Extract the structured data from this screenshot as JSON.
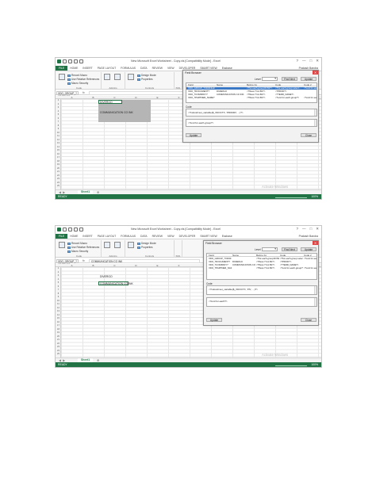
{
  "accent_color": "#217346",
  "selection_color": "#3a78c6",
  "screenshots": [
    {
      "window_title": "New Microsoft Excel Worksheet - Copy.xls [Compatibility Mode] - Excel",
      "window_controls": [
        "?",
        "—",
        "□",
        "✕"
      ],
      "tabs": [
        "FILE",
        "HOME",
        "INSERT",
        "PAGE LAYOUT",
        "FORMULAS",
        "DATA",
        "REVIEW",
        "VIEW",
        "DEVELOPER",
        "SMART VIEW",
        "Essbase"
      ],
      "user": "Prakash Bandra",
      "ribbon_items": [
        "Record Macro",
        "Use Relative References",
        "Macro Security",
        "Add-Ins",
        "COM Add-Ins",
        "Insert",
        "Design Mode",
        "Properties",
        "View Code",
        "Run Dialog",
        "Source",
        "Map Properties",
        "Expansion Packs",
        "Refresh Data",
        "Import",
        "Export",
        "Document Panel",
        "XML Maps",
        "Field Browser"
      ],
      "ribbon_groups": [
        "Code",
        "Add-Ins",
        "Controls",
        "XML",
        "Modify"
      ],
      "name_box": "XDO_GROUP_?XDOFILE?",
      "fx": "fx",
      "formula": "",
      "columns": [
        "A",
        "B",
        "C",
        "D",
        "E",
        "F",
        "G",
        "H",
        "I",
        "J",
        "K",
        "L"
      ],
      "rows": [
        "1",
        "2",
        "3",
        "4",
        "5",
        "6",
        "7",
        "8",
        "9",
        "10",
        "11",
        "12",
        "13",
        "14",
        "15",
        "16",
        "17",
        "18",
        "19",
        "20",
        "21",
        "22",
        "23",
        "24",
        "25"
      ],
      "cells": [
        {
          "text": "DIVERGO"
        },
        {
          "text": "COMMUNICATION CO INK"
        }
      ],
      "sheet_tab": "Sheet1",
      "status": "READY",
      "zoom": "100%",
      "watermark": "Activate Windows",
      "dialog": {
        "title": "Field Browser",
        "close": "✕",
        "level_label": "Level",
        "find_button": "Find Next",
        "update_button": "Update",
        "columns": [
          "Field",
          "Name",
          "Before Fo",
          "Code",
          "Code 2"
        ],
        "rows": [
          [
            "XDO_GROUP_?XDOFILE?",
            "",
            "<?for-each-group:ROW?>",
            "<?for-each-group select:...",
            "<?end for-each?>"
          ],
          [
            "XDO_?DOCUMENT?",
            "DIVERGO",
            "<?fbow-?:G1.B1?>",
            "<?PROD?>",
            ""
          ],
          [
            "XDO_?COMPANY?",
            "COMMUNICATION CO INK",
            "<?fbow-?:G1.B1?>",
            "<?TERR_NAME?>",
            ""
          ],
          [
            "XDO_?PARTNER_NAME?",
            "",
            "<?fbow-?:G1.B1?>",
            "<?end for-each-group?>",
            "<?end for-each?>"
          ]
        ],
        "code_label": "Code",
        "code_text_1": "<?xdoxslt:set_variable($_XDOCTX, 'PRODID', ...)?>",
        "code_text_2": "<?end for-each-group?>",
        "update_button_2": "Update",
        "close_button": "Close"
      }
    },
    {
      "window_title": "New Microsoft Excel Worksheet - Copy.xls [Compatibility Mode] - Excel",
      "window_controls": [
        "?",
        "—",
        "□",
        "✕"
      ],
      "tabs": [
        "FILE",
        "HOME",
        "INSERT",
        "PAGE LAYOUT",
        "FORMULAS",
        "DATA",
        "REVIEW",
        "VIEW",
        "DEVELOPER",
        "SMART VIEW",
        "Essbase"
      ],
      "user": "Prakash Bandra",
      "ribbon_items": [
        "Record Macro",
        "Use Relative References",
        "Macro Security",
        "Add-Ins",
        "COM Add-Ins",
        "Insert",
        "Design Mode",
        "Properties",
        "View Code",
        "Run Dialog",
        "Source",
        "Map Properties",
        "Expansion Packs",
        "Refresh Data",
        "Import",
        "Export",
        "Document Panel",
        "XML Maps",
        "Field Browser"
      ],
      "ribbon_groups": [
        "Code",
        "Add-Ins",
        "Controls",
        "XML",
        "Modify"
      ],
      "name_box": "XDO_GROUP_?XDOFILE?",
      "fx": "fx",
      "formula": "COMMUNICATION CO INK",
      "columns": [
        "A",
        "B",
        "C",
        "D",
        "E",
        "F",
        "G",
        "H",
        "I",
        "J",
        "K",
        "L"
      ],
      "rows": [
        "1",
        "2",
        "3",
        "4",
        "5",
        "6",
        "7",
        "8",
        "9",
        "10",
        "11",
        "12",
        "13",
        "14",
        "15",
        "16",
        "17",
        "18",
        "19",
        "20",
        "21",
        "22",
        "23",
        "24",
        "25"
      ],
      "cells": [
        {
          "text": "DIVERGO"
        },
        {
          "text": "COMMUNICATION CO INK"
        }
      ],
      "sheet_tab": "Sheet1",
      "status": "READY",
      "zoom": "100%",
      "watermark": "Activate Windows",
      "dialog": {
        "title": "Field Browser",
        "close": "✕",
        "level_label": "Level",
        "find_button": "Find Next",
        "update_button": "Update",
        "columns": [
          "Field",
          "Name",
          "Before Fo",
          "Code",
          "Code 2"
        ],
        "rows": [
          [
            "XDO_GROUP_?XDOFILE?",
            "",
            "<?for-each-group:ROW?>",
            "<?for-each-group select:...",
            "<?end for-each?>"
          ],
          [
            "XDO_?DOCUMENT?",
            "DIVERGO",
            "<?fbow-?:G1.B1?>",
            "<?PROD?>",
            ""
          ],
          [
            "XDO_?COMPANY?",
            "COMMUNICATION CO INK",
            "<?fbow-?:G1.B1?>",
            "<?TERR_NAME?>",
            ""
          ],
          [
            "XDO_?PARTNER_NAME?",
            "",
            "<?fbow-?:G1.B1?>",
            "<?end for-each-group?>",
            "<?end for-each?>"
          ]
        ],
        "code_label": "Code",
        "code_text_1": "<?xdoxslt:set_variable($_XDOCTX, 'PS', ...)?>",
        "code_text_2": "<?end for-each?>",
        "update_button_2": "Update",
        "close_button": "Close"
      }
    }
  ]
}
